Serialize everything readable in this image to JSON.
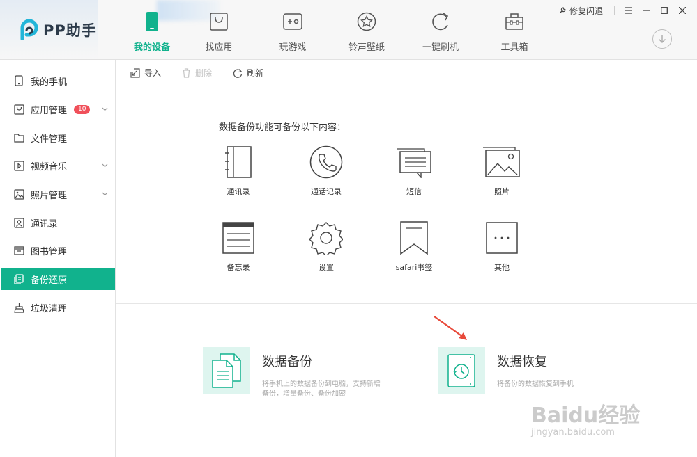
{
  "app": {
    "name": "PP助手"
  },
  "window": {
    "repair_label": "修复闪退"
  },
  "nav": [
    {
      "label": "我的设备",
      "icon": "phone-icon",
      "active": true
    },
    {
      "label": "找应用",
      "icon": "bag-icon"
    },
    {
      "label": "玩游戏",
      "icon": "gamepad-icon"
    },
    {
      "label": "铃声壁纸",
      "icon": "star-icon"
    },
    {
      "label": "一键刷机",
      "icon": "refresh-icon"
    },
    {
      "label": "工具箱",
      "icon": "toolbox-icon"
    }
  ],
  "sidebar": {
    "items": [
      {
        "label": "我的手机",
        "icon": "phone-icon"
      },
      {
        "label": "应用管理",
        "icon": "bag-icon",
        "badge": "10",
        "expandable": true
      },
      {
        "label": "文件管理",
        "icon": "folder-icon"
      },
      {
        "label": "视频音乐",
        "icon": "play-icon",
        "expandable": true
      },
      {
        "label": "照片管理",
        "icon": "photo-icon",
        "expandable": true
      },
      {
        "label": "通讯录",
        "icon": "contacts-icon"
      },
      {
        "label": "图书管理",
        "icon": "book-icon"
      },
      {
        "label": "备份还原",
        "icon": "backup-icon",
        "active": true
      },
      {
        "label": "垃圾清理",
        "icon": "broom-icon"
      }
    ]
  },
  "toolbar": {
    "import_label": "导入",
    "delete_label": "删除",
    "refresh_label": "刷新"
  },
  "backup": {
    "intro": "数据备份功能可备份以下内容：",
    "items": [
      {
        "label": "通讯录",
        "icon": "contacts-book-icon"
      },
      {
        "label": "通话记录",
        "icon": "phone-call-icon"
      },
      {
        "label": "短信",
        "icon": "message-icon"
      },
      {
        "label": "照片",
        "icon": "photos-icon"
      },
      {
        "label": "备忘录",
        "icon": "memo-icon"
      },
      {
        "label": "设置",
        "icon": "settings-gear-icon"
      },
      {
        "label": "safari书签",
        "icon": "bookmark-icon"
      },
      {
        "label": "其他",
        "icon": "more-icon"
      }
    ]
  },
  "cards": {
    "backup": {
      "title": "数据备份",
      "desc1": "将手机上的数据备份到电脑，支持新增",
      "desc2": "备份，增量备份、备份加密"
    },
    "restore": {
      "title": "数据恢复",
      "desc": "将备份的数据恢复到手机"
    }
  },
  "watermark": {
    "brand": "Baidu经验",
    "url": "jingyan.baidu.com"
  },
  "colors": {
    "accent": "#11b28d",
    "badge": "#f0505a",
    "annotation": "#e8493a"
  }
}
